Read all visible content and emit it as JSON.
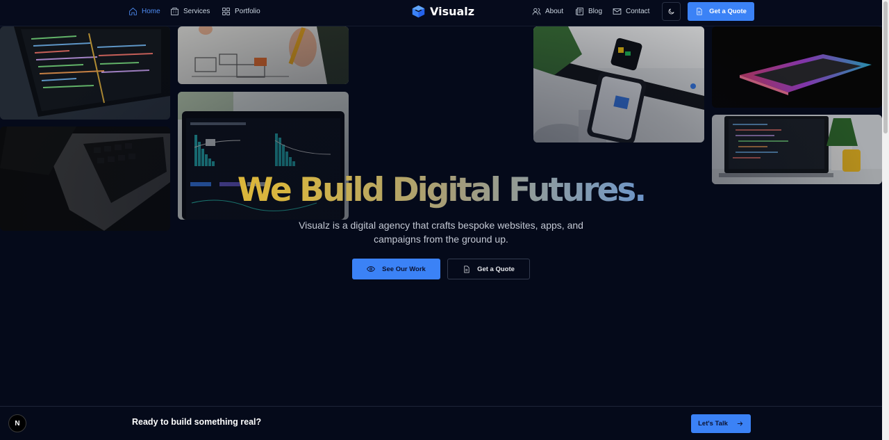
{
  "nav": {
    "links": [
      {
        "label": "Home",
        "icon": "home-icon",
        "active": true
      },
      {
        "label": "Services",
        "icon": "building-icon",
        "active": false
      },
      {
        "label": "Portfolio",
        "icon": "grid-icon",
        "active": false
      }
    ],
    "brand": "Visualz",
    "right_links": [
      {
        "label": "About",
        "icon": "users-icon"
      },
      {
        "label": "Blog",
        "icon": "newspaper-icon"
      },
      {
        "label": "Contact",
        "icon": "mail-icon"
      }
    ],
    "theme_toggle_icon": "moon-icon",
    "quote_label": "Get a Quote"
  },
  "hero": {
    "title": "We Build Digital Futures.",
    "subtitle": "Visualz is a digital agency that crafts bespoke websites, apps, and campaigns from the ground up.",
    "primary_cta": {
      "label": "See Our Work",
      "icon": "eye-icon"
    },
    "secondary_cta": {
      "label": "Get a Quote",
      "icon": "file-icon"
    }
  },
  "cta_bar": {
    "text": "Ready to build something real?",
    "button_label": "Let's Talk",
    "button_icon": "arrow-right-icon"
  },
  "dev_badge": "N",
  "colors": {
    "background": "#050a1a",
    "accent": "#3b82f6",
    "title_gradient": [
      "#f5b81c",
      "#d6b541",
      "#a39c7c",
      "#7d9ab8",
      "#3b82f6"
    ]
  }
}
